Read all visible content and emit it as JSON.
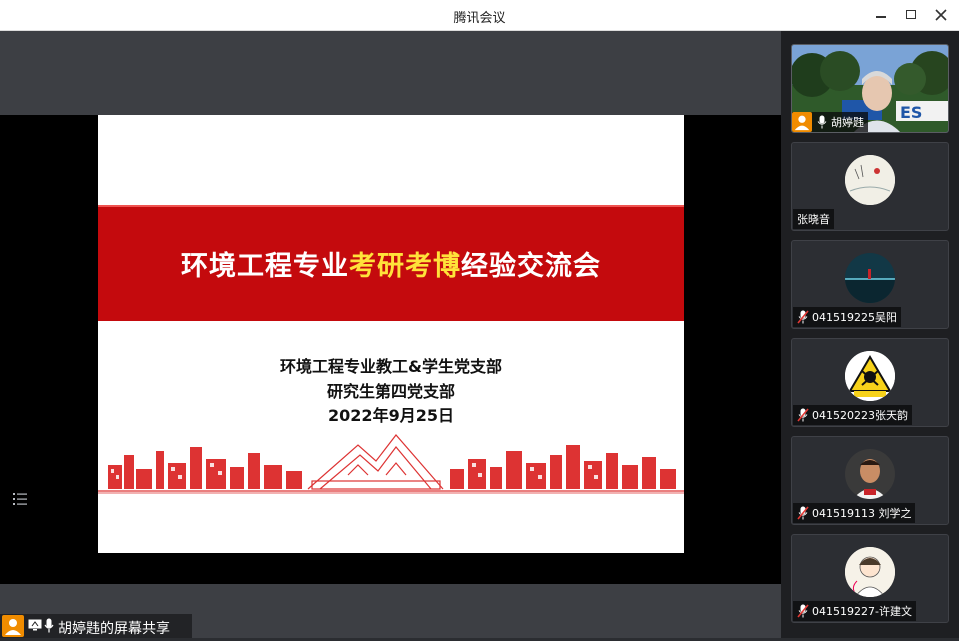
{
  "window": {
    "title": "腾讯会议",
    "controls": [
      "minimize",
      "maximize",
      "close"
    ]
  },
  "slide": {
    "title_part1": "环境工程专业",
    "title_highlight": "考研考博",
    "title_part2": "经验交流会",
    "line1": "环境工程专业教工&学生党支部",
    "line2": "研究生第四党支部",
    "line3": "2022年9月25日",
    "accent_color": "#c40a0d",
    "highlight_color": "#ffe23a"
  },
  "share_bar": {
    "label": "胡婷韪的屏幕共享"
  },
  "participants": [
    {
      "name": "胡婷韪",
      "icon": "camera-on",
      "speaking": true
    },
    {
      "name": "张晓音",
      "icon": "no-mic"
    },
    {
      "name": "041519225吴阳",
      "icon": "mic-muted-icon"
    },
    {
      "name": "041520223张天韵",
      "icon": "mic-muted-icon"
    },
    {
      "name": "041519113 刘学之",
      "icon": "mic-muted-icon"
    },
    {
      "name": "041519227-许建文",
      "icon": "mic-muted-icon"
    }
  ]
}
